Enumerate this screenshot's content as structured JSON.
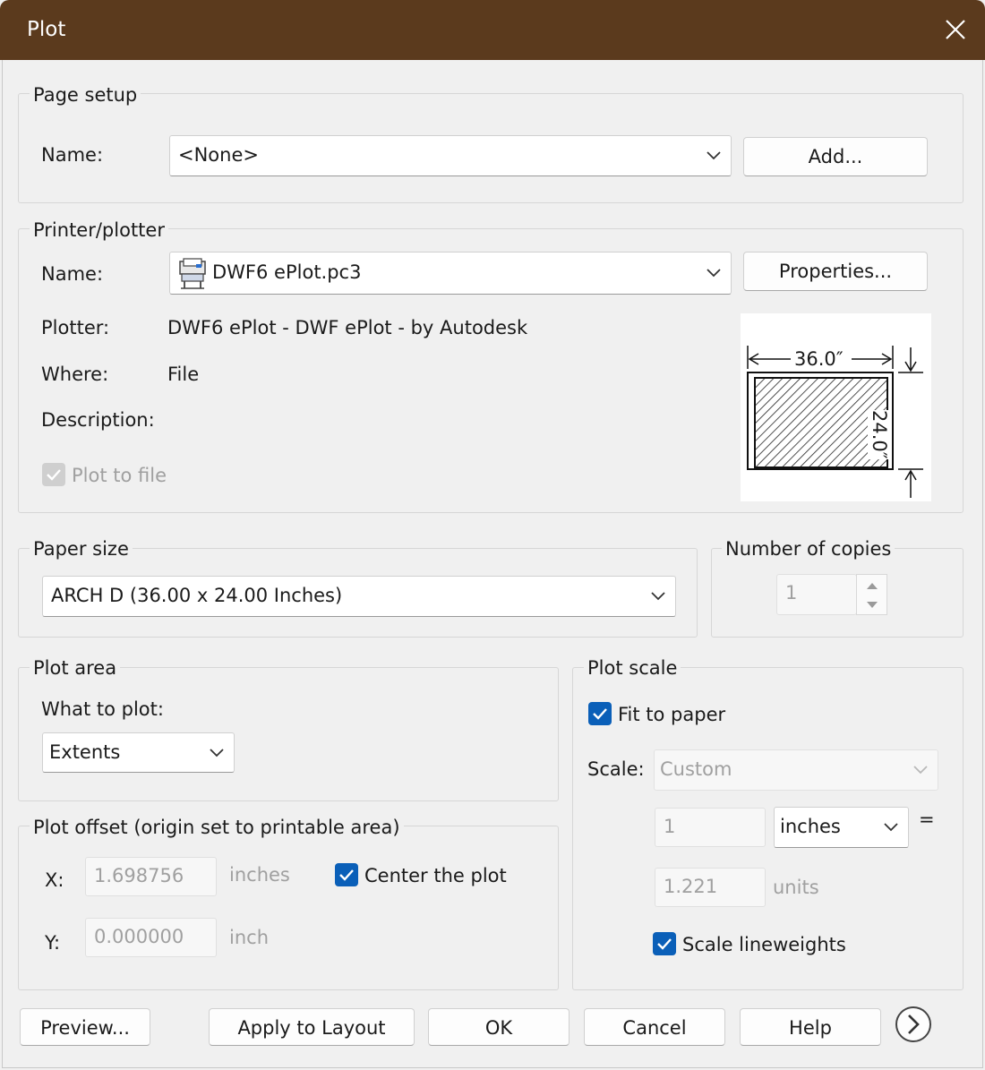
{
  "window": {
    "title": "Plot"
  },
  "page_setup": {
    "legend": "Page setup",
    "name_label": "Name:",
    "name_value": "<None>",
    "add_button": "Add..."
  },
  "printer": {
    "legend": "Printer/plotter",
    "name_label": "Name:",
    "name_value": "DWF6 ePlot.pc3",
    "properties_button": "Properties...",
    "plotter_label": "Plotter:",
    "plotter_value": "DWF6 ePlot - DWF ePlot - by Autodesk",
    "where_label": "Where:",
    "where_value": "File",
    "description_label": "Description:",
    "plot_to_file_label": "Plot to file",
    "plot_to_file_checked": true,
    "preview_width": "36.0″",
    "preview_height": "24.0″"
  },
  "paper_size": {
    "legend": "Paper size",
    "value": "ARCH D (36.00 x 24.00 Inches)"
  },
  "copies": {
    "legend": "Number of copies",
    "value": "1"
  },
  "plot_area": {
    "legend": "Plot area",
    "what_label": "What to plot:",
    "what_value": "Extents"
  },
  "plot_offset": {
    "legend": "Plot offset (origin set to printable area)",
    "x_label": "X:",
    "x_value": "1.698756",
    "x_unit": "inches",
    "y_label": "Y:",
    "y_value": "0.000000",
    "y_unit": "inch",
    "center_label": "Center the plot",
    "center_checked": true
  },
  "plot_scale": {
    "legend": "Plot scale",
    "fit_label": "Fit to paper",
    "fit_checked": true,
    "scale_label": "Scale:",
    "scale_value": "Custom",
    "value1": "1",
    "unit1": "inches",
    "equals": "=",
    "value2": "1.221",
    "unit2": "units",
    "lineweights_label": "Scale lineweights",
    "lineweights_checked": true
  },
  "footer": {
    "preview_button": "Preview...",
    "apply_button": "Apply to Layout",
    "ok_button": "OK",
    "cancel_button": "Cancel",
    "help_button": "Help"
  },
  "colors": {
    "titlebar": "#5b3a1d",
    "accent": "#0a5fb8",
    "background": "#f0f0f0"
  }
}
